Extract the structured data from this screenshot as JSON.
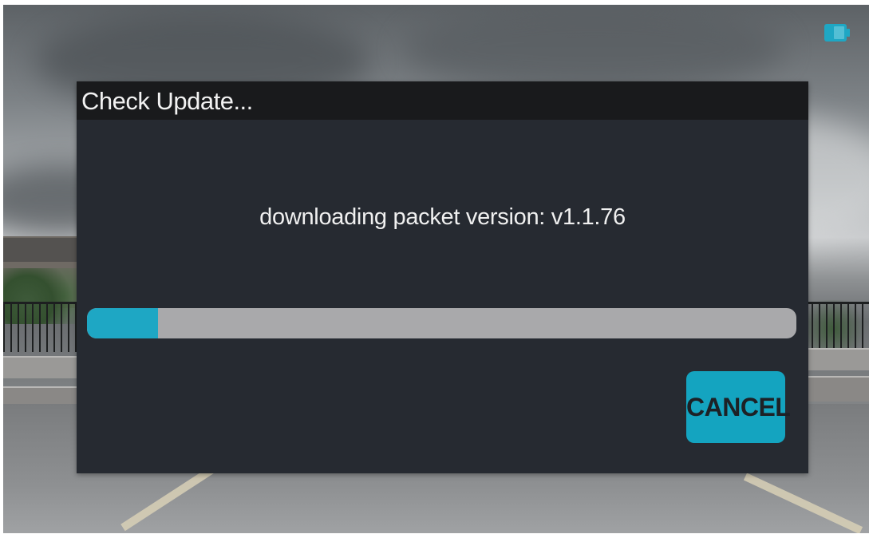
{
  "dialog": {
    "title": "Check Update...",
    "message": "downloading packet version: v1.1.76",
    "progress_fraction": 0.1,
    "cancel_label": "CANCEL"
  },
  "status_bar": {
    "battery_icon": "battery-icon"
  },
  "colors": {
    "accent": "#1ea7c4",
    "dialog_bg": "#262a31",
    "title_bar_bg": "#191a1c",
    "progress_track": "#a9a9ab",
    "button_bg": "#14a4c0"
  }
}
